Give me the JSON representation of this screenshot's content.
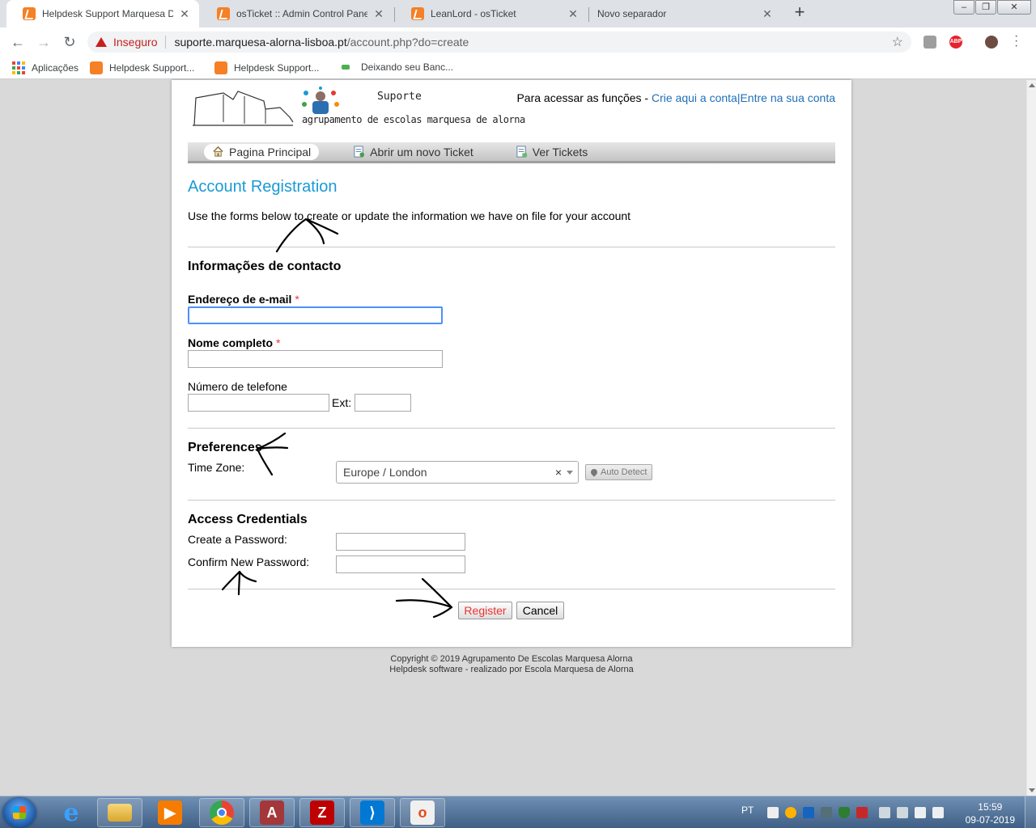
{
  "browser": {
    "tabs": [
      {
        "title": "Helpdesk Support Marquesa De A",
        "active": true
      },
      {
        "title": "osTicket :: Admin Control Panel",
        "active": false
      },
      {
        "title": "LeanLord - osTicket",
        "active": false
      },
      {
        "title": "Novo separador",
        "active": false
      }
    ],
    "security_label": "Inseguro",
    "url_host": "suporte.marquesa-alorna-lisboa.pt",
    "url_path": "/account.php?do=create",
    "extensions": [
      "pdf-extension-icon",
      "adblock-icon",
      "profile-avatar"
    ],
    "adblock_label": "ABP",
    "bookmarks": [
      {
        "label": "Aplicações",
        "icon": "apps-grid-icon"
      },
      {
        "label": "Helpdesk Support...",
        "icon": "osticket-icon"
      },
      {
        "label": "Helpdesk Support...",
        "icon": "osticket-icon"
      },
      {
        "label": "Deixando seu Banc...",
        "icon": "site-icon"
      }
    ]
  },
  "site": {
    "logo_line1": "Suporte",
    "logo_line2": "agrupamento de escolas marquesa de alorna",
    "access_prefix": "Para acessar as funções - ",
    "create_account_link": "Crie aqui a conta",
    "separator": "|",
    "login_link": "Entre na sua conta",
    "nav": [
      {
        "label": "Pagina Principal",
        "icon": "home-icon",
        "active": true
      },
      {
        "label": "Abrir um novo Ticket",
        "icon": "new-ticket-icon",
        "active": false
      },
      {
        "label": "Ver Tickets",
        "icon": "view-tickets-icon",
        "active": false
      }
    ]
  },
  "form": {
    "title": "Account Registration",
    "intro": "Use the forms below to create or update the information we have on file for your account",
    "contact_heading": "Informações de contacto",
    "email_label": "Endereço de e-mail",
    "email_value": "",
    "name_label": "Nome completo",
    "name_value": "",
    "phone_label": "Número de telefone",
    "phone_value": "",
    "ext_label": "Ext:",
    "ext_value": "",
    "required_mark": "*",
    "preferences_heading": "Preferences",
    "timezone_label": "Time Zone:",
    "timezone_value": "Europe / London",
    "timezone_clear": "×",
    "auto_detect_label": "Auto Detect",
    "credentials_heading": "Access Credentials",
    "password_label": "Create a Password:",
    "confirm_label": "Confirm New Password:",
    "register_label": "Register",
    "cancel_label": "Cancel"
  },
  "footer": {
    "line1": "Copyright © 2019 Agrupamento De Escolas Marquesa Alorna",
    "line2": "Helpdesk software - realizado por Escola Marquesa de Alorna"
  },
  "taskbar": {
    "apps": [
      "internet-explorer-icon",
      "file-explorer-icon",
      "media-player-icon",
      "chrome-icon",
      "access-icon",
      "filezilla-icon",
      "vscode-icon",
      "office-icon"
    ],
    "language": "PT",
    "time": "15:59",
    "date": "09-07-2019"
  },
  "colors": {
    "link": "#1f6fb8",
    "title": "#1a9ad6",
    "required": "#e33",
    "insecure": "#c5221f"
  }
}
